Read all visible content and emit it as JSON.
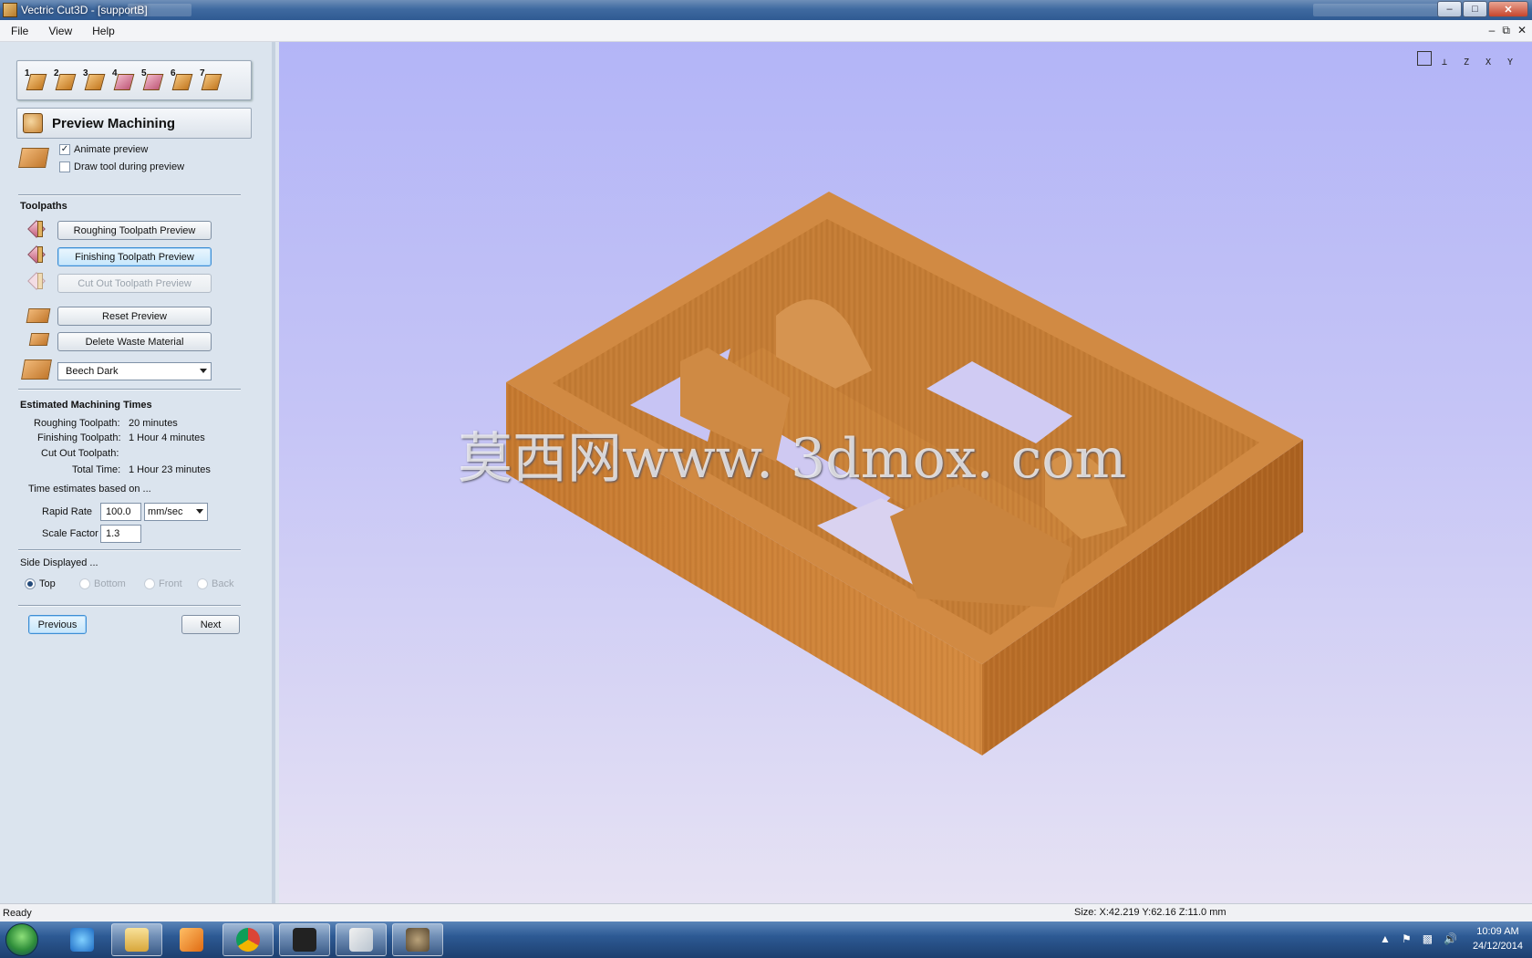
{
  "window": {
    "title": "Vectric Cut3D - [supportB]"
  },
  "menu": {
    "items": [
      "File",
      "View",
      "Help"
    ]
  },
  "steps": [
    "1",
    "2",
    "3",
    "4",
    "5",
    "6",
    "7"
  ],
  "page": {
    "step_number": "6",
    "title": "Preview Machining"
  },
  "preview_options": {
    "animate_preview": {
      "label": "Animate preview",
      "checked": true
    },
    "draw_tool": {
      "label": "Draw tool during preview",
      "checked": false
    }
  },
  "toolpaths": {
    "title": "Toolpaths",
    "roughing_label": "Roughing Toolpath Preview",
    "finishing_label": "Finishing Toolpath Preview",
    "cutout_label": "Cut Out Toolpath Preview",
    "reset_label": "Reset Preview",
    "delete_waste_label": "Delete Waste Material",
    "material": "Beech Dark"
  },
  "times": {
    "title": "Estimated Machining Times",
    "roughing_label": "Roughing Toolpath:",
    "roughing_value": "20 minutes",
    "finishing_label": "Finishing Toolpath:",
    "finishing_value": "1 Hour 4 minutes",
    "cutout_label": "Cut Out Toolpath:",
    "cutout_value": "",
    "total_label": "Total Time:",
    "total_value": "1 Hour 23 minutes",
    "based_on": "Time estimates based on ...",
    "rapid_rate_label": "Rapid Rate",
    "rapid_rate_value": "100.0",
    "rapid_rate_unit": "mm/sec",
    "scale_factor_label": "Scale Factor",
    "scale_factor_value": "1.3"
  },
  "sides": {
    "title": "Side Displayed ...",
    "options": [
      "Top",
      "Bottom",
      "Front",
      "Back"
    ],
    "selected": "Top"
  },
  "nav": {
    "previous": "Previous",
    "next": "Next"
  },
  "view": {
    "watermark": "莫西网www. 3dmox. com",
    "icons": [
      "fit-view-icon",
      "iso-view-icon",
      "z-view-icon",
      "x-view-icon",
      "y-view-icon"
    ],
    "axis_labels": [
      "Z",
      "X",
      "Y"
    ]
  },
  "status": {
    "left": "Ready",
    "size": "Size: X:42.219 Y:62.16 Z:11.0 mm"
  },
  "tray": {
    "time": "10:09 AM",
    "date": "24/12/2014"
  },
  "colors": {
    "wood": "#c98239",
    "view_top": "#b3b5f7",
    "view_bottom": "#e6e2f3"
  }
}
